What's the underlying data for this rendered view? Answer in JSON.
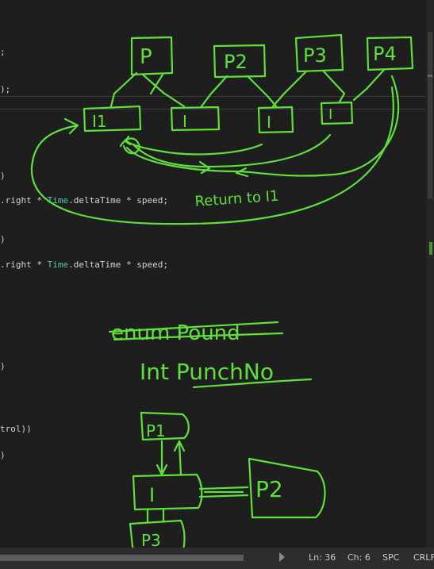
{
  "editor": {
    "lines": [
      {
        "text": ";"
      },
      {
        "text": ");"
      },
      {
        "text": ")"
      },
      {
        "text": ".right * ",
        "cls": "Time",
        "rest": ".deltaTime * speed;"
      },
      {
        "text": ")"
      },
      {
        "text": ".right * ",
        "cls": "Time",
        "rest": ".deltaTime * speed;"
      },
      {
        "text": ")"
      },
      {
        "text": "trol))"
      },
      {
        "text": ")"
      }
    ]
  },
  "sketch": {
    "top_boxes": [
      "P",
      "P2",
      "P3",
      "P4"
    ],
    "i_boxes": [
      "I1",
      "I",
      "I",
      "I"
    ],
    "return_note": "Return to I1",
    "struck_text": "enum Pound",
    "int_note": "Int PunchNo",
    "bottom": {
      "top_label": "P1",
      "middle_label": "I",
      "right_label": "P2",
      "bottom_label": "P3"
    },
    "ink_color": "#5fe03a"
  },
  "statusbar": {
    "ln": "Ln: 36",
    "ch": "Ch: 6",
    "spc": "SPC",
    "crlf": "CRLF"
  }
}
